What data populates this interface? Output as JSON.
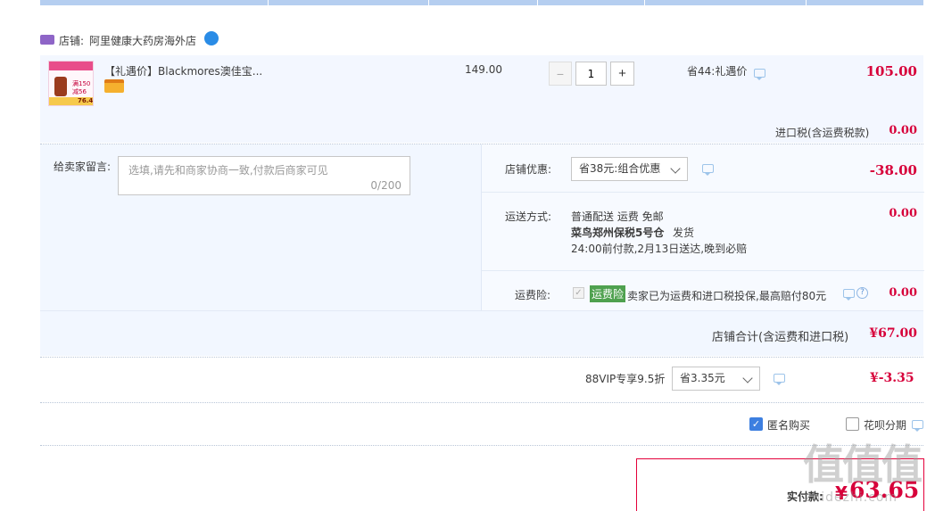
{
  "shop": {
    "label": "店铺:",
    "name": "阿里健康大药房海外店"
  },
  "product": {
    "title": "【礼遇价】Blackmores澳佳宝...",
    "unit_price": "149.00",
    "quantity": "1",
    "minus": "−",
    "plus": "+",
    "discount_note": "省44:礼遇价",
    "subtotal": "105.00",
    "thumb_text": {
      "line1": "满150",
      "line2": "减56",
      "price": "76.4"
    }
  },
  "tax": {
    "label": "进口税(含运费税款)",
    "value": "0.00"
  },
  "message": {
    "label": "给卖家留言:",
    "placeholder": "选填,请先和商家协商一致,付款后商家可见",
    "count": "0/200"
  },
  "shop_discount": {
    "label": "店铺优惠:",
    "selected": "省38元:组合优惠",
    "value": "-38.00"
  },
  "shipping": {
    "label": "运送方式:",
    "line1": "普通配送 运费 免邮",
    "line2_bold": "菜鸟郑州保税5号仓",
    "line2_suffix": "发货",
    "line3": "24:00前付款,2月13日送达,晚到必赔",
    "value": "0.00"
  },
  "insurance": {
    "label": "运费险:",
    "badge": "运费险",
    "desc": "卖家已为运费和进口税投保,最高赔付80元",
    "value": "0.00"
  },
  "shop_total": {
    "label": "店铺合计(含运费和进口税)",
    "value": "¥67.00"
  },
  "vip": {
    "label": "88VIP专享9.5折",
    "selected": "省3.35元",
    "value": "¥-3.35"
  },
  "options": {
    "anonymous": "匿名购买",
    "installment": "花呗分期"
  },
  "payment": {
    "label": "实付款:",
    "symbol": "¥",
    "value": "63.65"
  },
  "watermark": {
    "chars": "值值值",
    "url": "zhidezhi.com"
  },
  "colors": {
    "accent_red": "#d7003a",
    "light_blue_bg": "#f2f7ff",
    "border_blue": "#b9cfee",
    "insurance_green": "#4fa14f"
  }
}
